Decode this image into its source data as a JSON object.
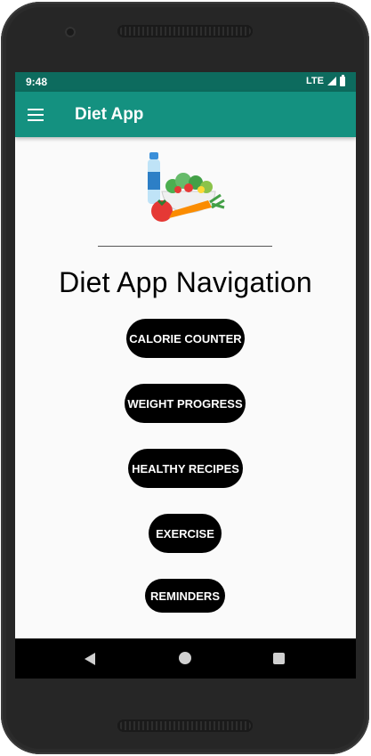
{
  "status_bar": {
    "time": "9:48",
    "network": "LTE"
  },
  "app_bar": {
    "title": "Diet App",
    "menu_icon": "hamburger-menu-icon"
  },
  "main": {
    "hero_image": "diet-food-illustration",
    "heading": "Diet App Navigation",
    "buttons": [
      {
        "label": "CALORIE COUNTER"
      },
      {
        "label": "WEIGHT PROGRESS"
      },
      {
        "label": "HEALTHY RECIPES"
      },
      {
        "label": "EXERCISE"
      },
      {
        "label": "REMINDERS"
      }
    ]
  },
  "system_nav": {
    "back_icon": "back-triangle-icon",
    "home_icon": "home-circle-icon",
    "recents_icon": "recents-square-icon"
  },
  "colors": {
    "status_bar": "#0d6b5e",
    "app_bar": "#149180",
    "button_bg": "#000000",
    "button_text": "#ffffff",
    "screen_bg": "#fafafa"
  }
}
